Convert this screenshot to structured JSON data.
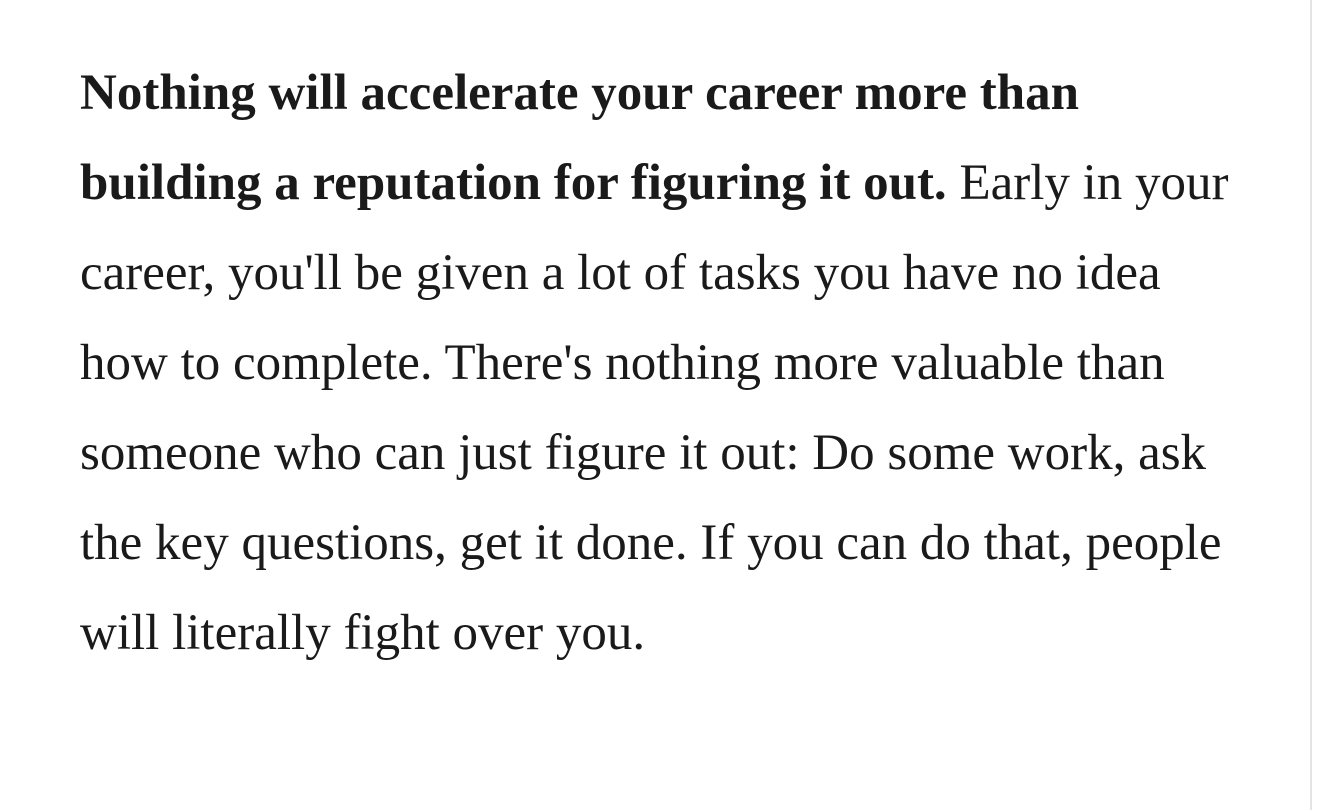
{
  "article": {
    "lead_bold": "Nothing will accelerate your career more than building a reputation for figuring it out.",
    "body": " Early in your career, you'll be given a lot of tasks you have no idea how to complete. There's nothing more valuable than someone who can just figure it out: Do some work, ask the key questions, get it done. If you can do that, people will literally fight over you."
  },
  "colors": {
    "text": "#1a1a1a",
    "background": "#ffffff",
    "scroll_edge": "#e4e4e4"
  }
}
